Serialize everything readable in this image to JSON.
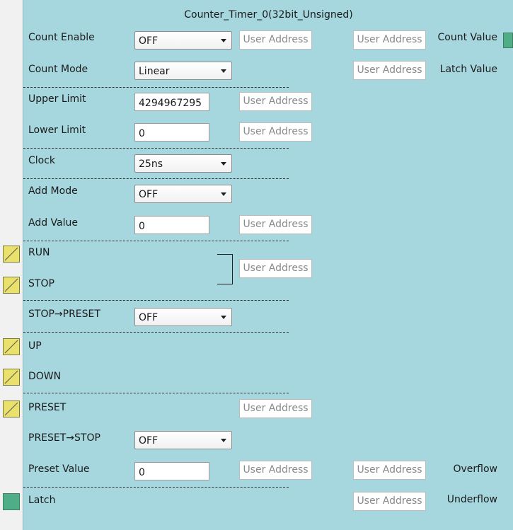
{
  "title": "Counter_Timer_0(32bit_Unsigned)",
  "user_address": "User Address",
  "count_enable": {
    "label": "Count Enable",
    "value": "OFF"
  },
  "count_mode": {
    "label": "Count Mode",
    "value": "Linear"
  },
  "upper_limit": {
    "label": "Upper Limit",
    "value": "4294967295"
  },
  "lower_limit": {
    "label": "Lower Limit",
    "value": "0"
  },
  "clock": {
    "label": "Clock",
    "value": "25ns"
  },
  "add_mode": {
    "label": "Add Mode",
    "value": "OFF"
  },
  "add_value": {
    "label": "Add Value",
    "value": "0"
  },
  "run": {
    "label": "RUN"
  },
  "stop": {
    "label": "STOP"
  },
  "stop_preset": {
    "label": "STOP→PRESET",
    "value": "OFF"
  },
  "up": {
    "label": "UP"
  },
  "down": {
    "label": "DOWN"
  },
  "preset": {
    "label": "PRESET"
  },
  "preset_stop": {
    "label": "PRESET→STOP",
    "value": "OFF"
  },
  "preset_value": {
    "label": "Preset Value",
    "value": "0"
  },
  "latch": {
    "label": "Latch"
  },
  "outputs": {
    "count_value": "Count Value",
    "latch_value": "Latch Value",
    "overflow": "Overflow",
    "underflow": "Underflow"
  },
  "colors": {
    "panel": "#a6d7df",
    "input_port": "#eae06c",
    "latch_port": "#4fae88"
  }
}
